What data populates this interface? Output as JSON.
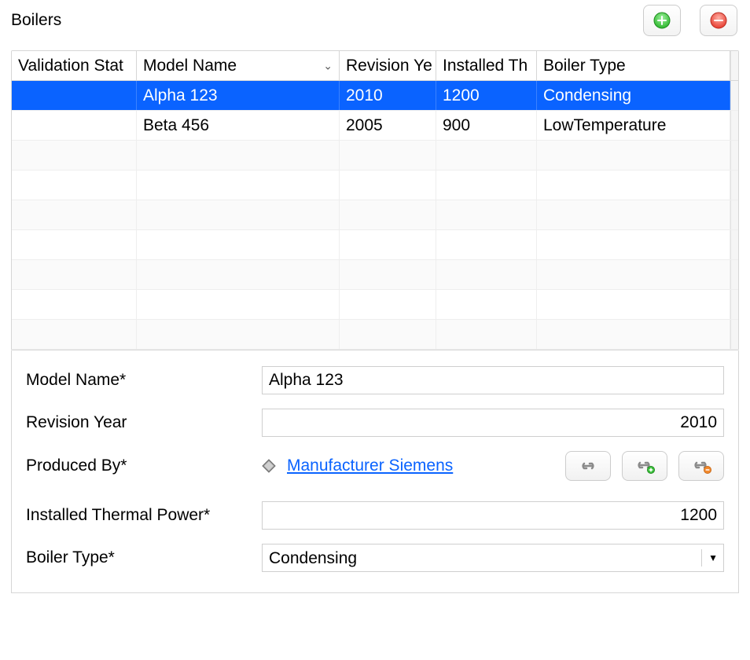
{
  "title": "Boilers",
  "columns": {
    "validation_status": "Validation Stat",
    "model_name": "Model Name",
    "revision_year": "Revision Ye",
    "installed_power": "Installed Th",
    "boiler_type": "Boiler Type"
  },
  "rows": [
    {
      "validation_status": "",
      "model_name": "Alpha 123",
      "revision_year": "2010",
      "installed_power": "1200",
      "boiler_type": "Condensing",
      "selected": true
    },
    {
      "validation_status": "",
      "model_name": "Beta 456",
      "revision_year": "2005",
      "installed_power": "900",
      "boiler_type": "LowTemperature",
      "selected": false
    }
  ],
  "detail": {
    "model_name": {
      "label": "Model Name*",
      "value": "Alpha 123"
    },
    "revision_year": {
      "label": "Revision Year",
      "value": "2010"
    },
    "produced_by": {
      "label": "Produced By*",
      "link_text": "Manufacturer Siemens"
    },
    "installed_power": {
      "label": "Installed Thermal Power*",
      "value": "1200"
    },
    "boiler_type": {
      "label": "Boiler Type*",
      "value": "Condensing"
    }
  },
  "icons": {
    "add": "add-icon",
    "remove": "remove-icon",
    "chevron": "chevron-down-icon",
    "diamond": "reference-diamond-icon",
    "link": "link-icon",
    "link_add": "link-add-icon",
    "link_remove": "link-remove-icon"
  }
}
